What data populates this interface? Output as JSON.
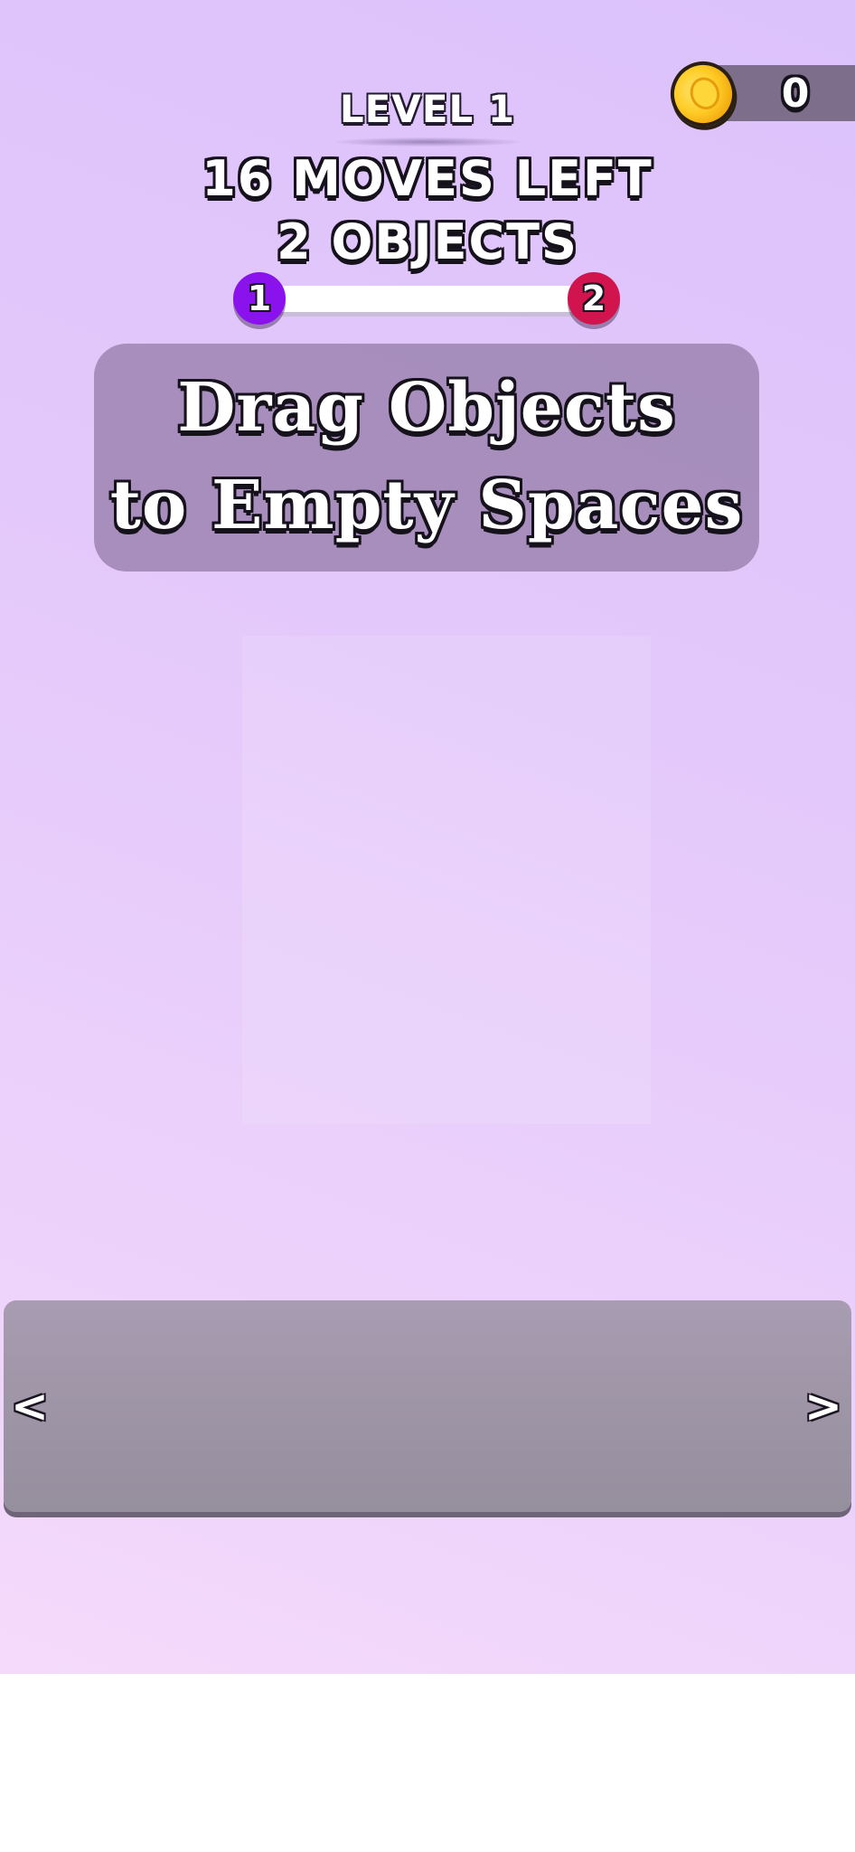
{
  "hud": {
    "level_title": "LEVEL 1",
    "moves_left": "16 MOVES LEFT",
    "objects_count": "2 OBJECTS",
    "progress_start": "1",
    "progress_end": "2",
    "progress_fraction": 0.0
  },
  "coins": {
    "count": "0",
    "icon": "coin-icon"
  },
  "instruction": {
    "line1": "Drag Objects",
    "line2": "to Empty Spaces"
  },
  "tray": {
    "left_arrow": "<",
    "right_arrow": ">"
  },
  "colors": {
    "background_top": "#dcc2fb",
    "background_bottom": "#f5dafb",
    "progress_start_node": "#8a12ec",
    "progress_end_node": "#d1144d",
    "panel": "#967eaa",
    "tray": "#9e95a6"
  }
}
